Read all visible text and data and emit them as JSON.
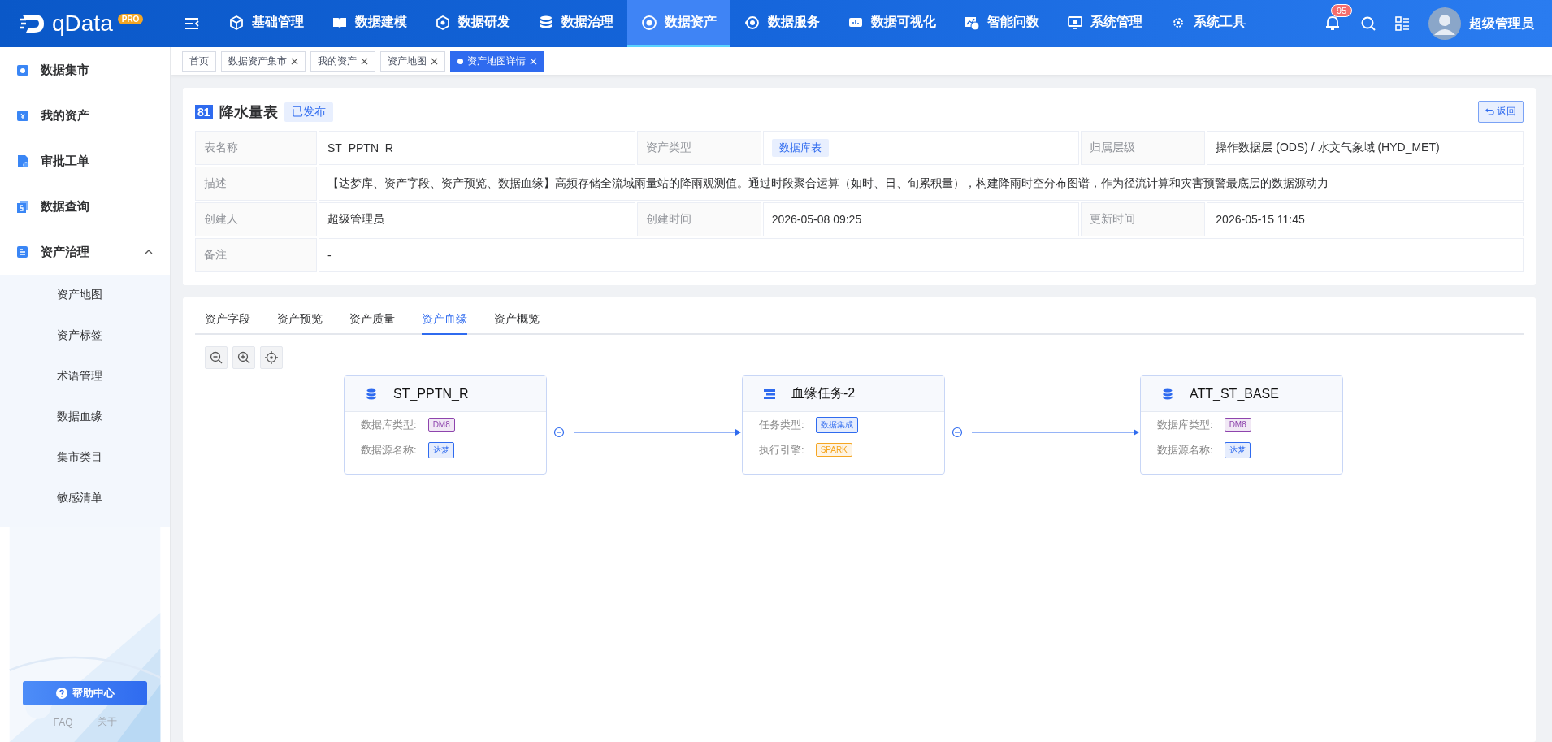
{
  "app": {
    "logo": "qData",
    "badge": "PRO"
  },
  "nav": [
    {
      "label": "基础管理",
      "selected": false
    },
    {
      "label": "数据建模",
      "selected": false
    },
    {
      "label": "数据研发",
      "selected": false
    },
    {
      "label": "数据治理",
      "selected": false
    },
    {
      "label": "数据资产",
      "selected": true
    },
    {
      "label": "数据服务",
      "selected": false
    },
    {
      "label": "数据可视化",
      "selected": false
    },
    {
      "label": "智能问数",
      "selected": false
    },
    {
      "label": "系统管理",
      "selected": false
    },
    {
      "label": "系统工具",
      "selected": false
    }
  ],
  "notifications": {
    "count": "95"
  },
  "user": {
    "name": "超级管理员"
  },
  "sidebar": {
    "items": [
      {
        "label": "数据集市",
        "selected": false
      },
      {
        "label": "我的资产",
        "selected": false
      },
      {
        "label": "审批工单",
        "selected": false
      },
      {
        "label": "数据查询",
        "selected": false
      },
      {
        "label": "资产治理",
        "selected": false,
        "expanded": true,
        "children": [
          {
            "label": "资产地图",
            "selected": false
          },
          {
            "label": "资产标签",
            "selected": false
          },
          {
            "label": "术语管理",
            "selected": false
          },
          {
            "label": "数据血缘",
            "selected": false
          },
          {
            "label": "集市类目",
            "selected": false
          },
          {
            "label": "敏感清单",
            "selected": false
          }
        ]
      }
    ]
  },
  "help": {
    "button": "帮助中心",
    "links": [
      "FAQ",
      "关于"
    ]
  },
  "page_tabs": [
    {
      "label": "首页",
      "selected": false,
      "closable": false
    },
    {
      "label": "数据资产集市",
      "selected": false,
      "closable": true
    },
    {
      "label": "我的资产",
      "selected": false,
      "closable": true
    },
    {
      "label": "资产地图",
      "selected": false,
      "closable": true
    },
    {
      "label": "资产地图详情",
      "selected": true,
      "closable": true
    }
  ],
  "asset": {
    "id": "81",
    "title": "降水量表",
    "status": "已发布",
    "back": "返回",
    "rows": [
      [
        {
          "label": "表名称",
          "value": "ST_PPTN_R",
          "kind": "text"
        },
        {
          "label": "资产类型",
          "value": "数据库表",
          "kind": "tag"
        },
        {
          "label": "归属层级",
          "value": "操作数据层 (ODS) / 水文气象域 (HYD_MET)",
          "kind": "text"
        }
      ],
      [
        {
          "label": "描述",
          "value": "【达梦库、资产字段、资产预览、数据血缘】高频存储全流域雨量站的降雨观测值。通过时段聚合运算（如时、日、旬累积量），构建降雨时空分布图谱，作为径流计算和灾害预警最底层的数据源动力",
          "kind": "text"
        }
      ],
      [
        {
          "label": "创建人",
          "value": "超级管理员",
          "kind": "text"
        },
        {
          "label": "创建时间",
          "value": "2026-05-08 09:25",
          "kind": "text"
        },
        {
          "label": "更新时间",
          "value": "2026-05-15 11:45",
          "kind": "text"
        }
      ],
      [
        {
          "label": "备注",
          "value": "-",
          "kind": "text"
        }
      ]
    ]
  },
  "detail_tabs": [
    {
      "label": "资产字段",
      "selected": false
    },
    {
      "label": "资产预览",
      "selected": false
    },
    {
      "label": "资产质量",
      "selected": false
    },
    {
      "label": "资产血缘",
      "selected": true
    },
    {
      "label": "资产概览",
      "selected": false
    }
  ],
  "lineage": {
    "nodes": [
      {
        "kind": "table",
        "title": "ST_PPTN_R",
        "props": [
          {
            "label": "数据库类型:",
            "value": "DM8",
            "color": "#8e44ad"
          },
          {
            "label": "数据源名称:",
            "value": "达梦",
            "color": "#2f6bef"
          }
        ]
      },
      {
        "kind": "task",
        "title": "血缘任务-2",
        "props": [
          {
            "label": "任务类型:",
            "value": "数据集成",
            "color": "#2f6bef"
          },
          {
            "label": "执行引擎:",
            "value": "SPARK",
            "color": "#f5a623"
          }
        ]
      },
      {
        "kind": "table",
        "title": "ATT_ST_BASE",
        "props": [
          {
            "label": "数据库类型:",
            "value": "DM8",
            "color": "#8e44ad"
          },
          {
            "label": "数据源名称:",
            "value": "达梦",
            "color": "#2f6bef"
          }
        ]
      }
    ]
  }
}
